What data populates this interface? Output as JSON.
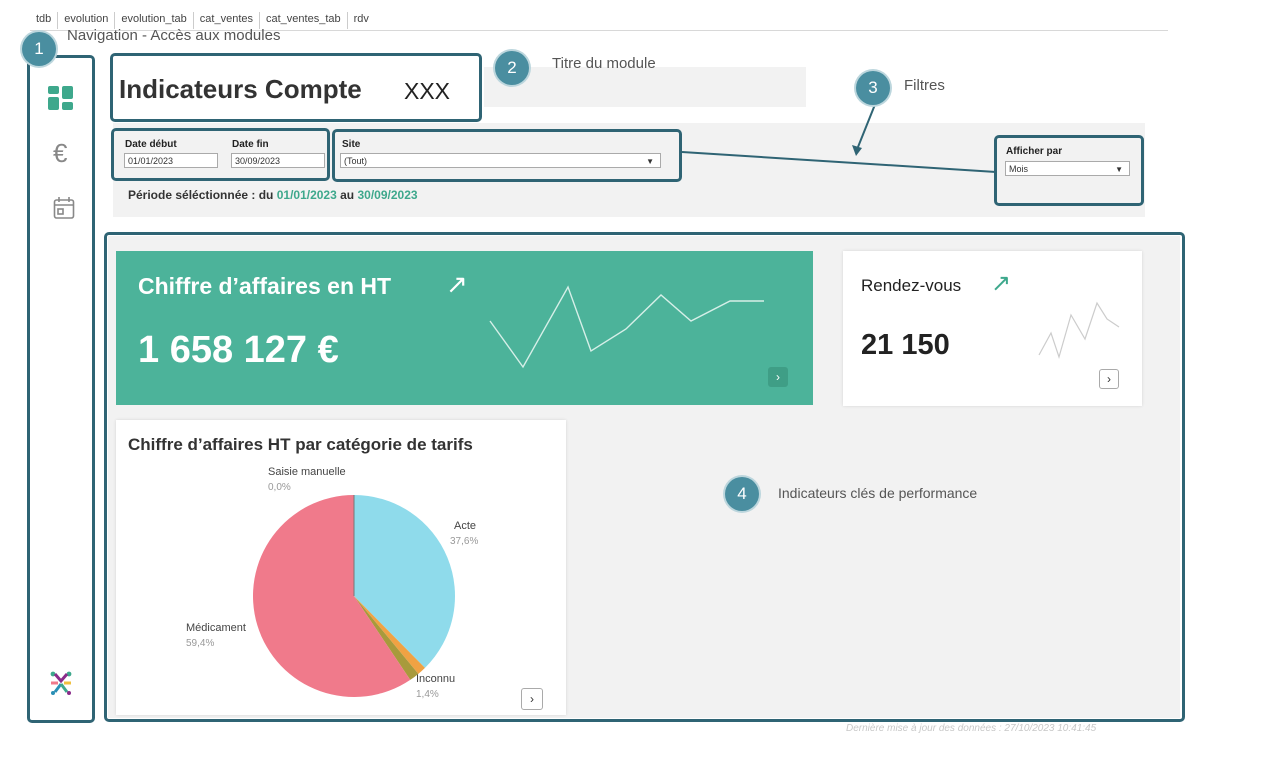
{
  "tabs": [
    "tdb",
    "evolution",
    "evolution_tab",
    "cat_ventes",
    "cat_ventes_tab",
    "rdv"
  ],
  "annotations": {
    "nav": {
      "num": "1",
      "label": "Navigation - Accès aux modules"
    },
    "title": {
      "num": "2",
      "label": "Titre du module"
    },
    "filters": {
      "num": "3",
      "label": "Filtres"
    },
    "kpi": {
      "num": "4",
      "label": "Indicateurs clés de performance"
    }
  },
  "sidebar": {
    "items": [
      {
        "icon": "dashboard-icon"
      },
      {
        "icon": "euro-icon",
        "glyph": "€"
      },
      {
        "icon": "calendar-icon"
      }
    ],
    "logo": "logo-icon"
  },
  "header": {
    "title": "Indicateurs Compte",
    "account": "XXX"
  },
  "filters": {
    "date_start": {
      "label": "Date début",
      "value": "01/01/2023"
    },
    "date_end": {
      "label": "Date fin",
      "value": "30/09/2023"
    },
    "site": {
      "label": "Site",
      "value": "(Tout)"
    },
    "display_by": {
      "label": "Afficher par",
      "value": "Mois"
    },
    "period_prefix": "Période séléctionnée : du",
    "period_start": "01/01/2023",
    "period_mid": "au",
    "period_end": "30/09/2023"
  },
  "kpis": {
    "revenue": {
      "title": "Chiffre d’affaires en HT",
      "value": "1 658 127 €",
      "arrow": "↗",
      "nav": "›"
    },
    "rdv": {
      "title": "Rendez-vous",
      "value": "21 150",
      "arrow": "↗",
      "nav": "›"
    }
  },
  "pie_card": {
    "title": "Chiffre d’affaires HT par catégorie de tarifs",
    "nav": "›"
  },
  "chart_data": {
    "type": "pie",
    "title": "Chiffre d’affaires HT par catégorie de tarifs",
    "slices": [
      {
        "label": "Acte",
        "pct_label": "37,6%",
        "value": 37.6,
        "color": "#8fdbeb"
      },
      {
        "label": "Inconnu",
        "pct_label": "1,4%",
        "value": 1.4,
        "color": "#f0a243"
      },
      {
        "label": "",
        "pct_label": "",
        "value": 1.6,
        "color": "#a89a3c"
      },
      {
        "label": "Médicament",
        "pct_label": "59,4%",
        "value": 59.4,
        "color": "#f07a8b"
      },
      {
        "label": "Saisie manuelle",
        "pct_label": "0,0%",
        "value": 0.0,
        "color": "#777777"
      }
    ]
  },
  "footer": {
    "last_update": "Dernière mise à jour des données : 27/10/2023 10:41:45"
  },
  "colors": {
    "teal": "#4cb39a",
    "accent": "#3ea88c",
    "annot": "#4a8ea0",
    "highlight": "#2f6474"
  }
}
